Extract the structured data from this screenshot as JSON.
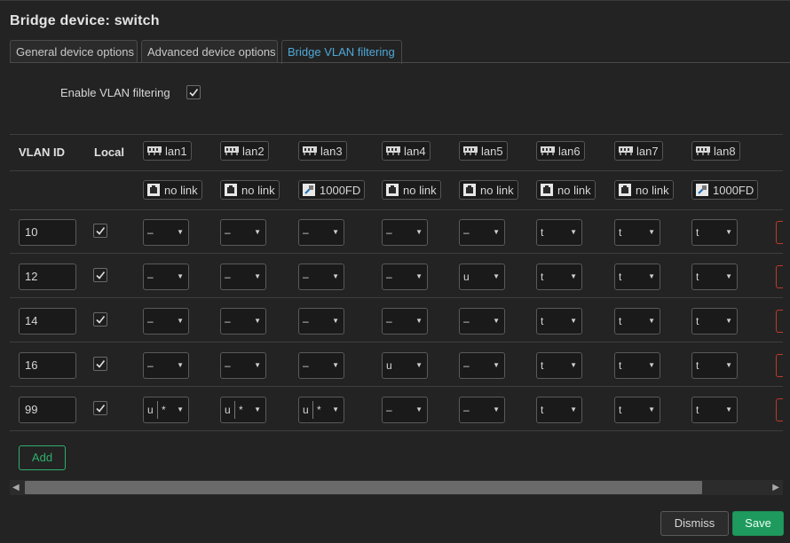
{
  "title": "Bridge device: switch",
  "tabs": [
    {
      "label": "General device options",
      "active": false
    },
    {
      "label": "Advanced device options",
      "active": false
    },
    {
      "label": "Bridge VLAN filtering",
      "active": true
    }
  ],
  "enable_vlan_filtering": {
    "label": "Enable VLAN filtering",
    "checked": true
  },
  "table": {
    "headers": {
      "vlan_id": "VLAN ID",
      "local": "Local"
    },
    "ports": [
      {
        "name": "lan1",
        "status": "no link",
        "linked": false
      },
      {
        "name": "lan2",
        "status": "no link",
        "linked": false
      },
      {
        "name": "lan3",
        "status": "1000FD",
        "linked": true
      },
      {
        "name": "lan4",
        "status": "no link",
        "linked": false
      },
      {
        "name": "lan5",
        "status": "no link",
        "linked": false
      },
      {
        "name": "lan6",
        "status": "no link",
        "linked": false
      },
      {
        "name": "lan7",
        "status": "no link",
        "linked": false
      },
      {
        "name": "lan8",
        "status": "1000FD",
        "linked": true
      }
    ],
    "rows": [
      {
        "vlan_id": "10",
        "local": true,
        "cells": [
          "–",
          "–",
          "–",
          "–",
          "–",
          "t",
          "t",
          "t"
        ]
      },
      {
        "vlan_id": "12",
        "local": true,
        "cells": [
          "–",
          "–",
          "–",
          "–",
          "u",
          "t",
          "t",
          "t"
        ]
      },
      {
        "vlan_id": "14",
        "local": true,
        "cells": [
          "–",
          "–",
          "–",
          "–",
          "–",
          "t",
          "t",
          "t"
        ]
      },
      {
        "vlan_id": "16",
        "local": true,
        "cells": [
          "–",
          "–",
          "–",
          "u",
          "–",
          "t",
          "t",
          "t"
        ]
      },
      {
        "vlan_id": "99",
        "local": true,
        "cells": [
          "u|*",
          "u|*",
          "u|*",
          "–",
          "–",
          "t",
          "t",
          "t"
        ]
      }
    ]
  },
  "buttons": {
    "add": "Add",
    "dismiss": "Dismiss",
    "save": "Save"
  },
  "scroll": {
    "left": "◀",
    "right": "▶"
  },
  "colors": {
    "accent": "#4fa8d8",
    "add": "#2eaf6e",
    "save": "#1f9a5e",
    "delete": "#c0392b"
  }
}
